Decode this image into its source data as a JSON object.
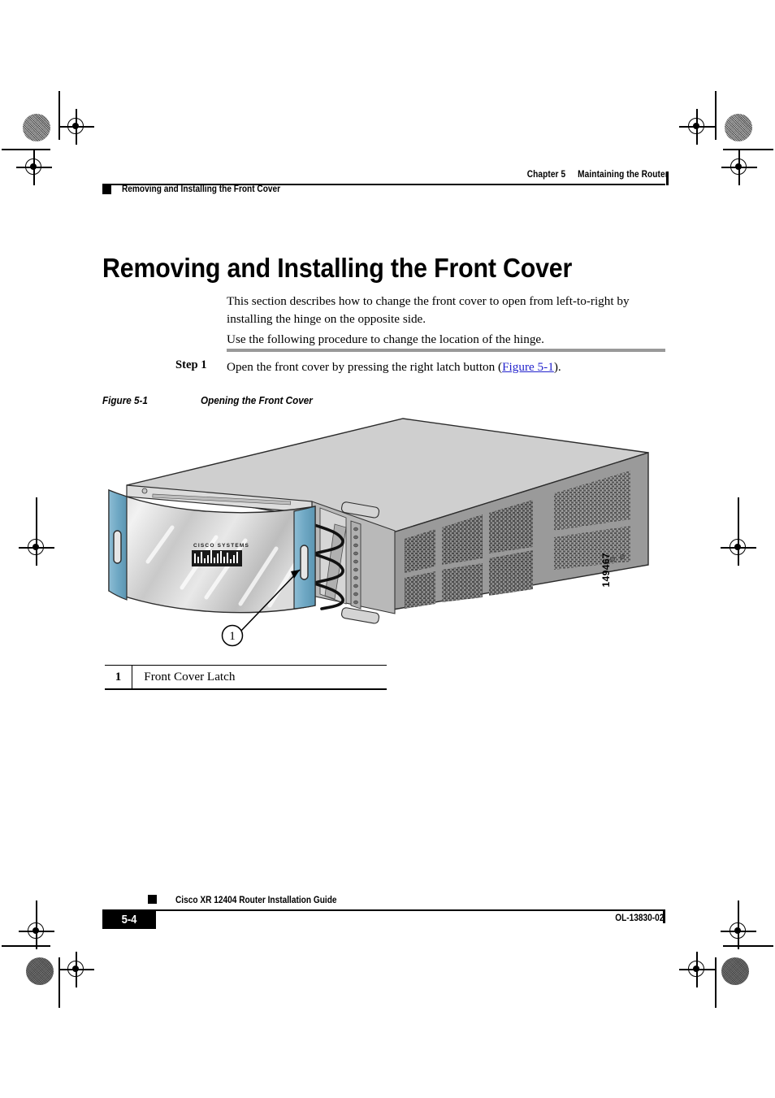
{
  "document": {
    "header": {
      "chapter": "Chapter 5",
      "chapter_title": "Maintaining the Router",
      "running_section": "Removing and Installing the Front Cover"
    },
    "title": "Removing and Installing the Front Cover",
    "intro_paragraph": "This section describes how to change the front cover to open from left-to-right by installing the hinge on the opposite side.",
    "procedure_lead": "Use the following procedure to change the location of the hinge.",
    "step": {
      "label": "Step 1",
      "text_before_link": "Open the front cover by pressing the right latch button (",
      "link": "Figure 5-1",
      "text_after_link": ")."
    },
    "figure": {
      "number": "Figure 5-1",
      "title": "Opening the Front Cover",
      "art_id": "149467",
      "callouts": [
        {
          "num": "1",
          "label": "Front Cover Latch"
        }
      ]
    },
    "footer": {
      "page_number": "5-4",
      "guide_title": "Cisco XR 12404 Router Installation Guide",
      "doc_number": "OL-13830-02"
    },
    "colors": {
      "link": "#2222cc",
      "rule_gray": "#999999",
      "accent_teal": "#6fa8c4",
      "chassis_light": "#cfcfcf",
      "chassis_mid": "#9a9a9a"
    }
  }
}
